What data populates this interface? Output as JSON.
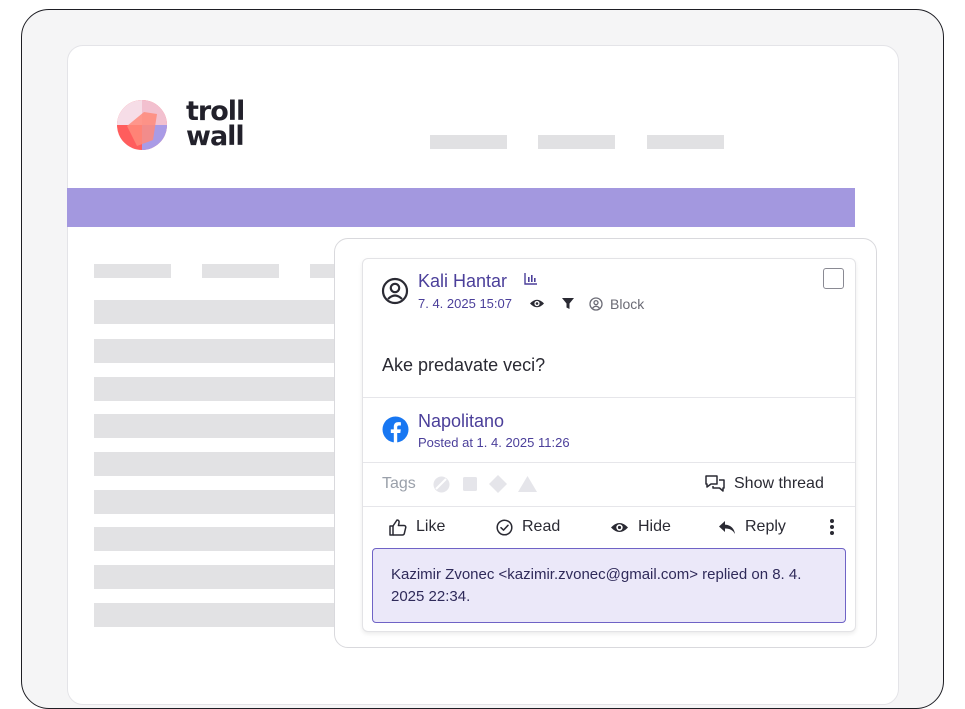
{
  "brand": {
    "logo_text_line1": "troll",
    "logo_text_line2": "wall",
    "colors": {
      "accent": "#a398df",
      "link": "#4b3f9a",
      "reply_bg": "#ebe8f9",
      "reply_border": "#6f63c6",
      "facebook": "#1877f2"
    }
  },
  "comment": {
    "author": "Kali Hantar",
    "timestamp": "7. 4. 2025 15:07",
    "block_label": "Block",
    "text": "Ake predavate veci?",
    "icons": [
      "user-circle-icon",
      "stats-icon",
      "eye-icon",
      "filter-icon",
      "block-icon"
    ]
  },
  "post": {
    "page_name": "Napolitano",
    "posted_at": "Posted at 1. 4. 2025 11:26",
    "network_icon": "facebook-icon"
  },
  "tags": {
    "label": "Tags",
    "shapes": [
      "circle-tag-icon",
      "square-tag-icon",
      "diamond-tag-icon",
      "triangle-tag-icon"
    ],
    "show_thread_label": "Show thread"
  },
  "actions": {
    "like": "Like",
    "read": "Read",
    "hide": "Hide",
    "reply": "Reply"
  },
  "reply_notice": {
    "text": "Kazimir Zvonec <kazimir.zvonec@gmail.com> replied on 8. 4. 2025 22:34."
  }
}
